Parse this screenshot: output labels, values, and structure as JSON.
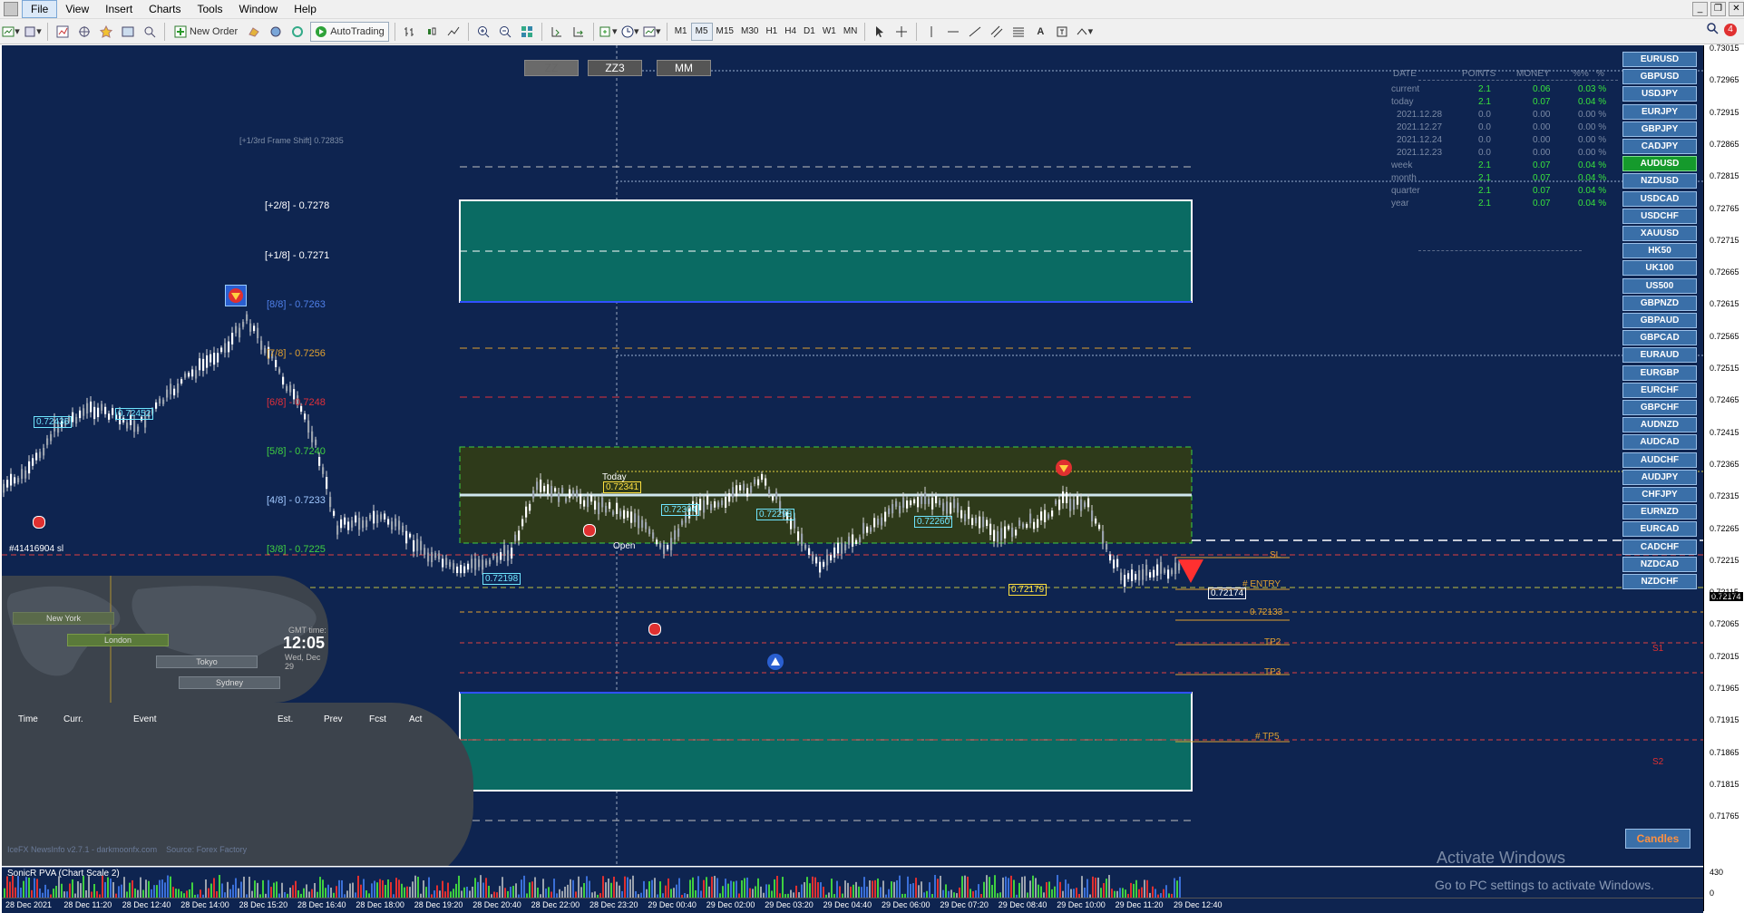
{
  "menu": {
    "items": [
      "File",
      "View",
      "Insert",
      "Charts",
      "Tools",
      "Window",
      "Help"
    ]
  },
  "toolbar": {
    "new_order": "New Order",
    "autotrading": "AutoTrading",
    "timeframes": [
      "M1",
      "M5",
      "M15",
      "M30",
      "H1",
      "H4",
      "D1",
      "W1",
      "MN"
    ],
    "selected_timeframe": "M5"
  },
  "chart": {
    "zz_buttons": [
      "ZZ",
      "ZZ3",
      "MM"
    ],
    "frame_shift": "[+1/3rd Frame Shift]  0.72835",
    "murrey": [
      {
        "label": "[+2/8] - 0.7278",
        "color": "#ffffff"
      },
      {
        "label": "[+1/8] - 0.7271",
        "color": "#ffffff"
      },
      {
        "label": "[8/8] - 0.7263",
        "color": "#3f6fe0"
      },
      {
        "label": "[7/8] - 0.7256",
        "color": "#e0a030"
      },
      {
        "label": "[6/8] - 0.7248",
        "color": "#e0303a"
      },
      {
        "label": "[5/8] - 0.7240",
        "color": "#40d040"
      },
      {
        "label": "[4/8] - 0.7233",
        "color": "#a0c8ff"
      },
      {
        "label": "[3/8] - 0.7225",
        "color": "#40d040"
      }
    ],
    "order_label": "#41416904 sl",
    "price_tags": [
      "0.72436",
      "0.72452",
      "0.72341",
      "0.72304",
      "0.72298",
      "0.72260",
      "0.72198",
      "0.72179",
      "0.72174",
      "0.72133"
    ],
    "today_label": "Today",
    "open_label": "Open",
    "trade_levels": [
      "SL",
      "# ENTRY",
      "0.72133",
      "TP2",
      "TP3",
      "# TP5"
    ],
    "pivots": [
      "S1",
      "S2"
    ],
    "candles_btn": "Candles"
  },
  "stats": {
    "headers": [
      "DATE",
      "POINTS",
      "MONEY",
      "%%",
      "%"
    ],
    "rows": [
      {
        "d": "current",
        "p": "2.1",
        "m": "0.06",
        "pc": "0.03 %"
      },
      {
        "d": "today",
        "p": "2.1",
        "m": "0.07",
        "pc": "0.04 %"
      },
      {
        "d": "2021.12.28",
        "p": "0.0",
        "m": "0.00",
        "pc": "0.00 %"
      },
      {
        "d": "2021.12.27",
        "p": "0.0",
        "m": "0.00",
        "pc": "0.00 %"
      },
      {
        "d": "2021.12.24",
        "p": "0.0",
        "m": "0.00",
        "pc": "0.00 %"
      },
      {
        "d": "2021.12.23",
        "p": "0.0",
        "m": "0.00",
        "pc": "0.00 %"
      },
      {
        "d": "week",
        "p": "2.1",
        "m": "0.07",
        "pc": "0.04 %"
      },
      {
        "d": "month",
        "p": "2.1",
        "m": "0.07",
        "pc": "0.04 %"
      },
      {
        "d": "quarter",
        "p": "2.1",
        "m": "0.07",
        "pc": "0.04 %"
      },
      {
        "d": "year",
        "p": "2.1",
        "m": "0.07",
        "pc": "0.04 %"
      }
    ]
  },
  "symbols": [
    "EURUSD",
    "GBPUSD",
    "USDJPY",
    "EURJPY",
    "GBPJPY",
    "CADJPY",
    "AUDUSD",
    "NZDUSD",
    "USDCAD",
    "USDCHF",
    "XAUUSD",
    "HK50",
    "UK100",
    "US500",
    "GBPNZD",
    "GBPAUD",
    "GBPCAD",
    "EURAUD",
    "EURGBP",
    "EURCHF",
    "GBPCHF",
    "AUDNZD",
    "AUDCAD",
    "AUDCHF",
    "AUDJPY",
    "CHFJPY",
    "EURNZD",
    "EURCAD",
    "CADCHF",
    "NZDCAD",
    "NZDCHF"
  ],
  "active_symbol": "AUDUSD",
  "sessions": {
    "labels": [
      "New York",
      "London",
      "Tokyo",
      "Sydney"
    ],
    "gmt_label": "GMT time:",
    "time": "12:05",
    "date": "Wed, Dec 29"
  },
  "news": {
    "headers": [
      "Time",
      "Curr.",
      "Event",
      "Est.",
      "Prev",
      "Fcst",
      "Act"
    ],
    "footer": "IceFX NewsInfo v2.7.1 - darkmoonfx.com    Source: Forex Factory"
  },
  "prices": [
    "0.73015",
    "0.72965",
    "0.72915",
    "0.72865",
    "0.72815",
    "0.72765",
    "0.72715",
    "0.72665",
    "0.72615",
    "0.72565",
    "0.72515",
    "0.72465",
    "0.72415",
    "0.72365",
    "0.72315",
    "0.72265",
    "0.72215",
    "0.72174",
    "0.72115",
    "0.72065",
    "0.72015",
    "0.71965",
    "0.71915",
    "0.71865",
    "0.71815",
    "0.71765",
    "430",
    "0"
  ],
  "times": [
    "28 Dec 2021",
    "28 Dec 11:20",
    "28 Dec 12:40",
    "28 Dec 14:00",
    "28 Dec 15:20",
    "28 Dec 16:40",
    "28 Dec 18:00",
    "28 Dec 19:20",
    "28 Dec 20:40",
    "28 Dec 22:00",
    "28 Dec 23:20",
    "29 Dec 00:40",
    "29 Dec 02:00",
    "29 Dec 03:20",
    "29 Dec 04:40",
    "29 Dec 06:00",
    "29 Dec 07:20",
    "29 Dec 08:40",
    "29 Dec 10:00",
    "29 Dec 11:20",
    "29 Dec 12:40"
  ],
  "subwindow": {
    "label": "SonicR PVA  (Chart Scale 2)"
  },
  "watermark": {
    "title": "Activate Windows",
    "sub": "Go to PC settings to activate Windows."
  },
  "badge": "4",
  "colors": {
    "bg": "#0e2450",
    "green_zone": "#0a6b63",
    "yellow_zone": "#2e3a1a"
  }
}
